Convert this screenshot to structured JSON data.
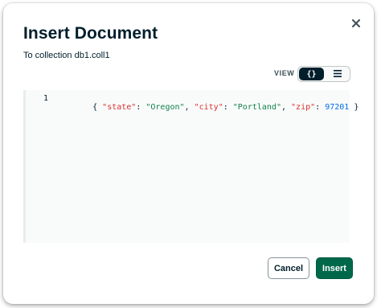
{
  "dialog": {
    "title": "Insert Document",
    "subtitle": "To collection db1.coll1",
    "close_icon": "close-icon"
  },
  "view": {
    "label": "VIEW",
    "options": [
      {
        "name": "json-view",
        "glyph": "{}",
        "active": true
      },
      {
        "name": "list-view",
        "icon": "list-icon",
        "active": false
      }
    ]
  },
  "editor": {
    "lines": [
      {
        "number": "1",
        "tokens": [
          {
            "t": "punc",
            "v": "{ "
          },
          {
            "t": "key",
            "v": "\"state\""
          },
          {
            "t": "punc",
            "v": ": "
          },
          {
            "t": "str",
            "v": "\"Oregon\""
          },
          {
            "t": "punc",
            "v": ", "
          },
          {
            "t": "key",
            "v": "\"city\""
          },
          {
            "t": "punc",
            "v": ": "
          },
          {
            "t": "str",
            "v": "\"Portland\""
          },
          {
            "t": "punc",
            "v": ", "
          },
          {
            "t": "key",
            "v": "\"zip\""
          },
          {
            "t": "punc",
            "v": ": "
          },
          {
            "t": "num",
            "v": "97201"
          },
          {
            "t": "punc",
            "v": " }"
          }
        ]
      }
    ]
  },
  "buttons": {
    "cancel_label": "Cancel",
    "insert_label": "Insert"
  },
  "colors": {
    "primary": "#00684a",
    "text": "#001e2b",
    "key": "#db3030",
    "string": "#12824d",
    "number": "#016ee9"
  }
}
